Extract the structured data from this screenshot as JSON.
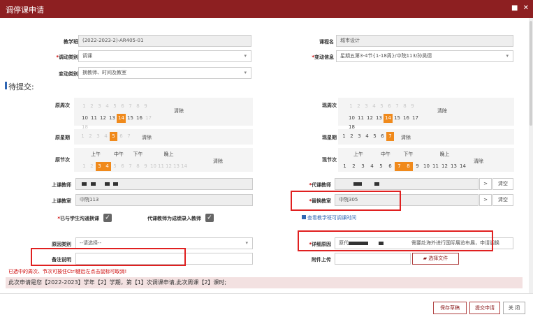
{
  "window": {
    "title": "调停课申请",
    "controls": "■ ✕"
  },
  "labels": {
    "teaching_class": "教学班",
    "course_name": "课程名",
    "adjust_type": "调动类别",
    "change_info": "变动信息",
    "change_type": "变动类别",
    "orig_weeks": "原周次",
    "new_weeks": "现周次",
    "orig_weekday": "原星期",
    "new_weekday": "现星期",
    "orig_periods": "原节次",
    "new_periods": "现节次",
    "teacher": "上课教师",
    "sub_teacher": "代课教师",
    "classroom": "上课教室",
    "new_classroom": "替换教室",
    "communicated": "已与学生沟通换课",
    "sub_grade_entry": "代课教师为成绩录入教师",
    "reason_type": "原因类别",
    "detail_reason": "详细原因",
    "remark": "备注说明",
    "attachment": "附件上传"
  },
  "values": {
    "teaching_class": "(2022-2023-2)-AR405-01",
    "course_name": "城市设计",
    "adjust_type": "调课",
    "change_info": "星期五第3-4节{1-18周}/中院113/孙昊德",
    "change_type": "换教师、时间及教室",
    "classroom": "中院113",
    "new_classroom": "中院305",
    "reason_type_placeholder": "--请选择--",
    "detail_reason_start": "原代",
    "detail_reason_end": "需要赴海外进行国际展览布展，申请调换",
    "remark": ""
  },
  "section_title": "待提交:",
  "weeks": {
    "row1": [
      "1",
      "2",
      "3",
      "4",
      "5",
      "6",
      "7",
      "8",
      "9"
    ],
    "row2": [
      "10",
      "11",
      "12",
      "13",
      "14",
      "15",
      "16",
      "17",
      "18"
    ],
    "orig_selected": "14",
    "new_selected": "14"
  },
  "weekdays": {
    "items": [
      "1",
      "2",
      "3",
      "4",
      "5",
      "6",
      "7"
    ],
    "orig_selected": "5",
    "new_selected": "7"
  },
  "periods": {
    "groups": [
      "上午",
      "中午",
      "下午",
      "晚上"
    ],
    "items": [
      "1",
      "2",
      "3",
      "4",
      "5",
      "6",
      "7",
      "8",
      "9",
      "10",
      "11",
      "12",
      "13",
      "14"
    ],
    "orig_selected": [
      "3",
      "4"
    ],
    "new_selected": [
      "7",
      "8"
    ]
  },
  "clear_label": "清除",
  "clear_empty_label": "清空",
  "arrow_label": ">",
  "view_link": "查看教学班可调课时间",
  "choose_file": "选择文件",
  "note": "已选中的周次、节次可按住Ctrl键后左点击鼠标可取消!",
  "info": "此次申请是您【2022-2023】学年【2】学期，第【1】次调课申请,此次周课【2】课时;",
  "buttons": {
    "save": "保存草稿",
    "submit": "提交申请",
    "close": "关 闭"
  },
  "colors": {
    "title_bar": "#8d1f21",
    "selected": "#f08a1c",
    "accent": "#2f66b3",
    "highlight": "#e02020"
  }
}
